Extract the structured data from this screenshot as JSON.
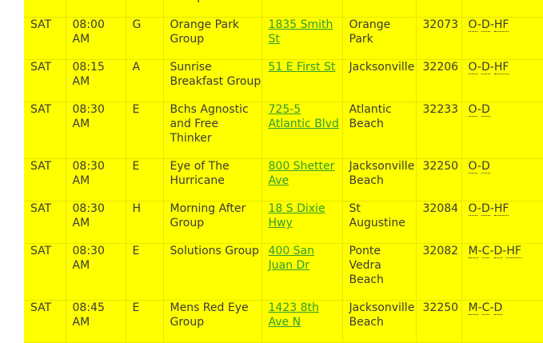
{
  "partial_row": {
    "day": "",
    "time_tail": "AM",
    "group_tail": "Group",
    "city_tail": "Beach"
  },
  "rows": [
    {
      "day": "SAT",
      "time": "08:00 AM",
      "district": "G",
      "group": "Orange Park Group",
      "address": "1835 Smith St",
      "city": "Orange Park",
      "zip": "32073",
      "types": [
        "O",
        "D",
        "HF"
      ]
    },
    {
      "day": "SAT",
      "time": "08:15 AM",
      "district": "A",
      "group": "Sunrise Breakfast Group",
      "address": "51 E First St",
      "city": "Jacksonville",
      "zip": "32206",
      "types": [
        "O",
        "D",
        "HF"
      ]
    },
    {
      "day": "SAT",
      "time": "08:30 AM",
      "district": "E",
      "group": "Bchs Agnostic and Free Thinker",
      "address": "725-5 Atlantic Blvd",
      "city": "Atlantic Beach",
      "zip": "32233",
      "types": [
        "O",
        "D"
      ]
    },
    {
      "day": "SAT",
      "time": "08:30 AM",
      "district": "E",
      "group": "Eye of The Hurricane",
      "address": "800 Shetter Ave",
      "city": "Jacksonville Beach",
      "zip": "32250",
      "types": [
        "O",
        "D"
      ]
    },
    {
      "day": "SAT",
      "time": "08:30 AM",
      "district": "H",
      "group": "Morning After Group",
      "address": "18 S Dixie Hwy",
      "city": "St Augustine",
      "zip": "32084",
      "types": [
        "O",
        "D",
        "HF"
      ]
    },
    {
      "day": "SAT",
      "time": "08:30 AM",
      "district": "E",
      "group": "Solutions Group",
      "address": "400 San Juan Dr",
      "city": "Ponte Vedra Beach",
      "zip": "32082",
      "types": [
        "M",
        "C",
        "D",
        "HF"
      ]
    },
    {
      "day": "SAT",
      "time": "08:45 AM",
      "district": "E",
      "group": "Mens Red Eye Group",
      "address": "1423 8th Ave N",
      "city": "Jacksonville Beach",
      "zip": "32250",
      "types": [
        "M",
        "C",
        "D"
      ]
    }
  ],
  "colors": {
    "row_bg": "#ffff00",
    "link": "#2e9d2e",
    "text": "#3a3a3a"
  }
}
